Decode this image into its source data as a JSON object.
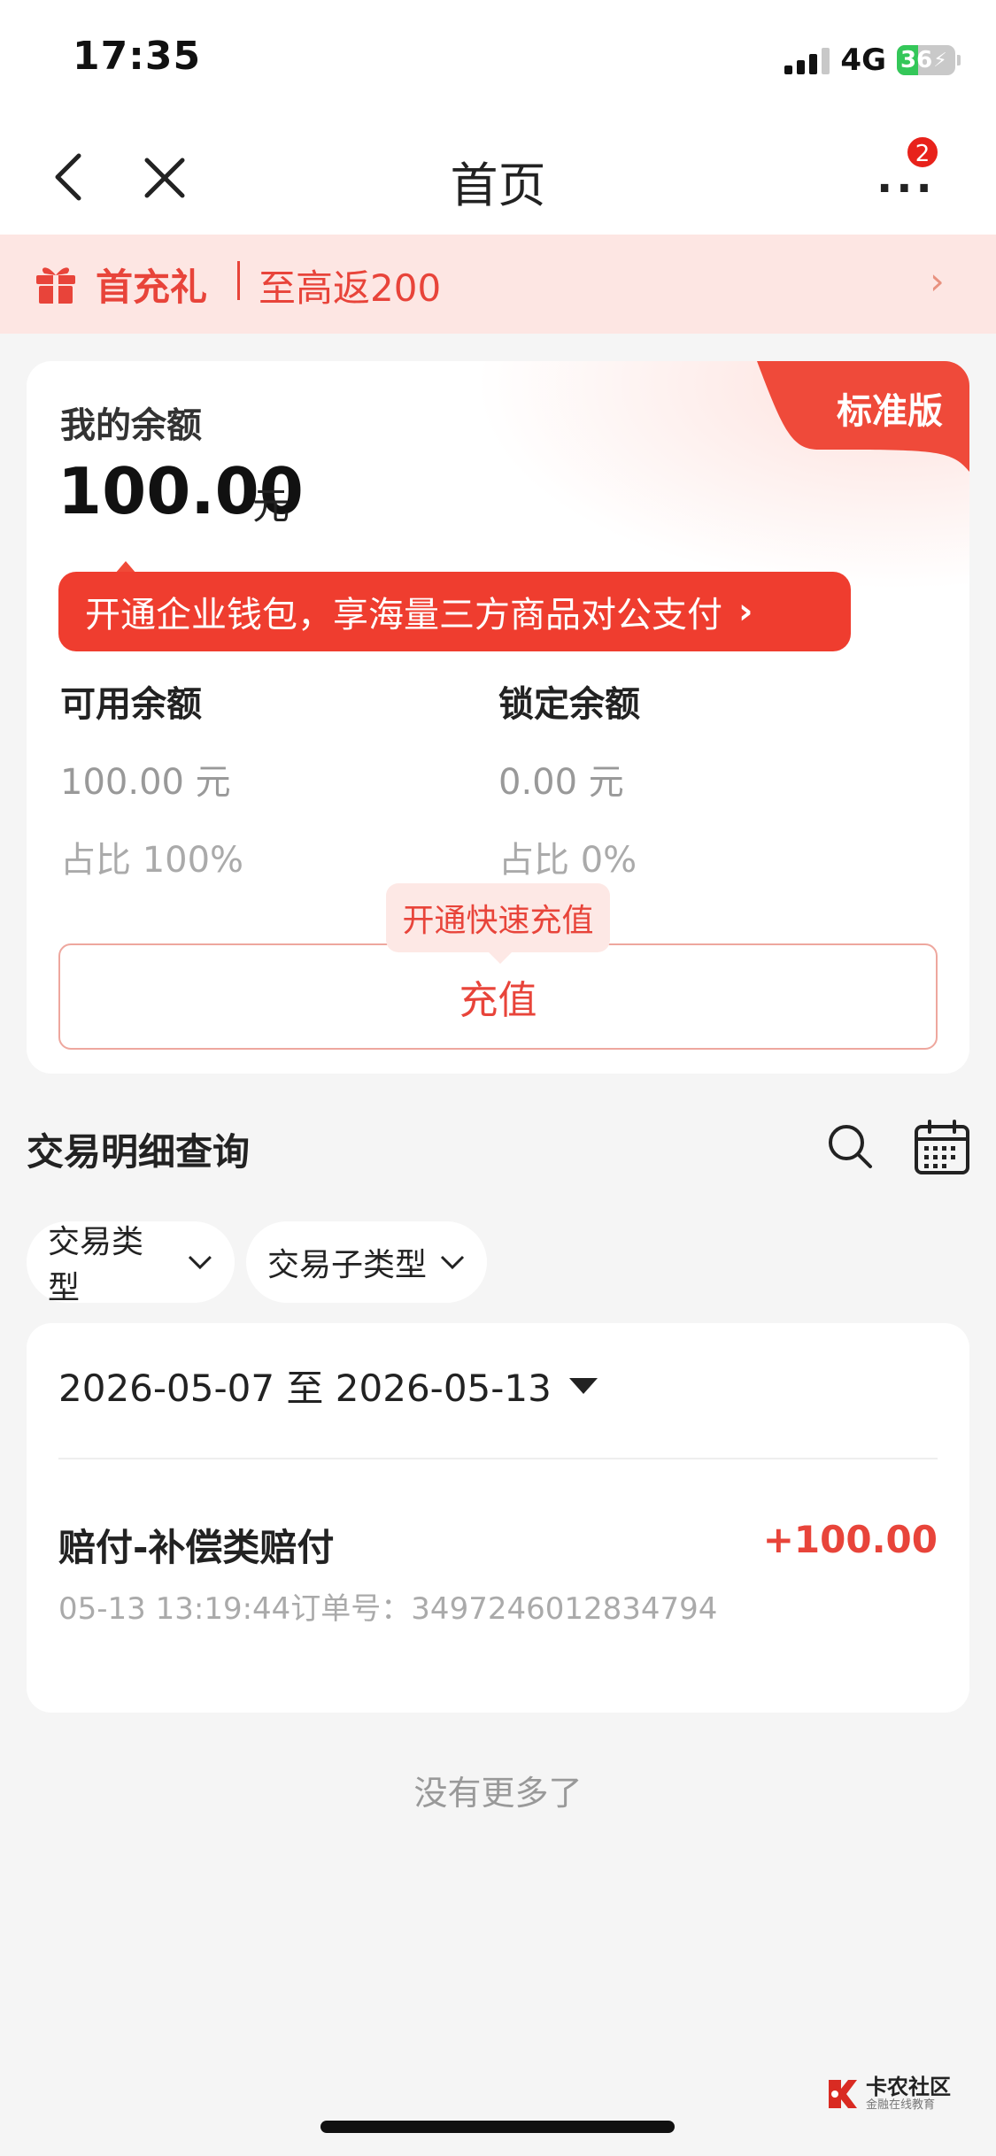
{
  "status_bar": {
    "time": "17:35",
    "network": "4G",
    "battery": "36"
  },
  "nav": {
    "title": "首页",
    "badge": "2",
    "more_icon": "ellipsis-icon"
  },
  "promo": {
    "title": "首充礼",
    "text": "至高返200"
  },
  "balance_card": {
    "edition_badge": "标准版",
    "label": "我的余额",
    "amount": "100.00",
    "unit": "元",
    "tip": "开通企业钱包，享海量三方商品对公支付",
    "available": {
      "label": "可用余额",
      "value": "100.00 元",
      "ratio": "占比 100%"
    },
    "locked": {
      "label": "锁定余额",
      "value": "0.00 元",
      "ratio": "占比 0%"
    },
    "quick_tip": "开通快速充值",
    "recharge_label": "充值"
  },
  "transactions": {
    "title": "交易明细查询",
    "filters": [
      "交易类型",
      "交易子类型"
    ],
    "date_range": "2026-05-07 至 2026-05-13",
    "items": [
      {
        "name": "赔付-补偿类赔付",
        "amount": "+100.00",
        "meta": "05-13 13:19:44订单号：3497246012834794"
      }
    ],
    "end_text": "没有更多了"
  },
  "watermark": {
    "title": "卡农社区",
    "subtitle": "金融在线教育"
  },
  "colors": {
    "accent": "#e8443a",
    "promo_bg": "#fde6e3",
    "page_bg": "#f5f5f5"
  }
}
